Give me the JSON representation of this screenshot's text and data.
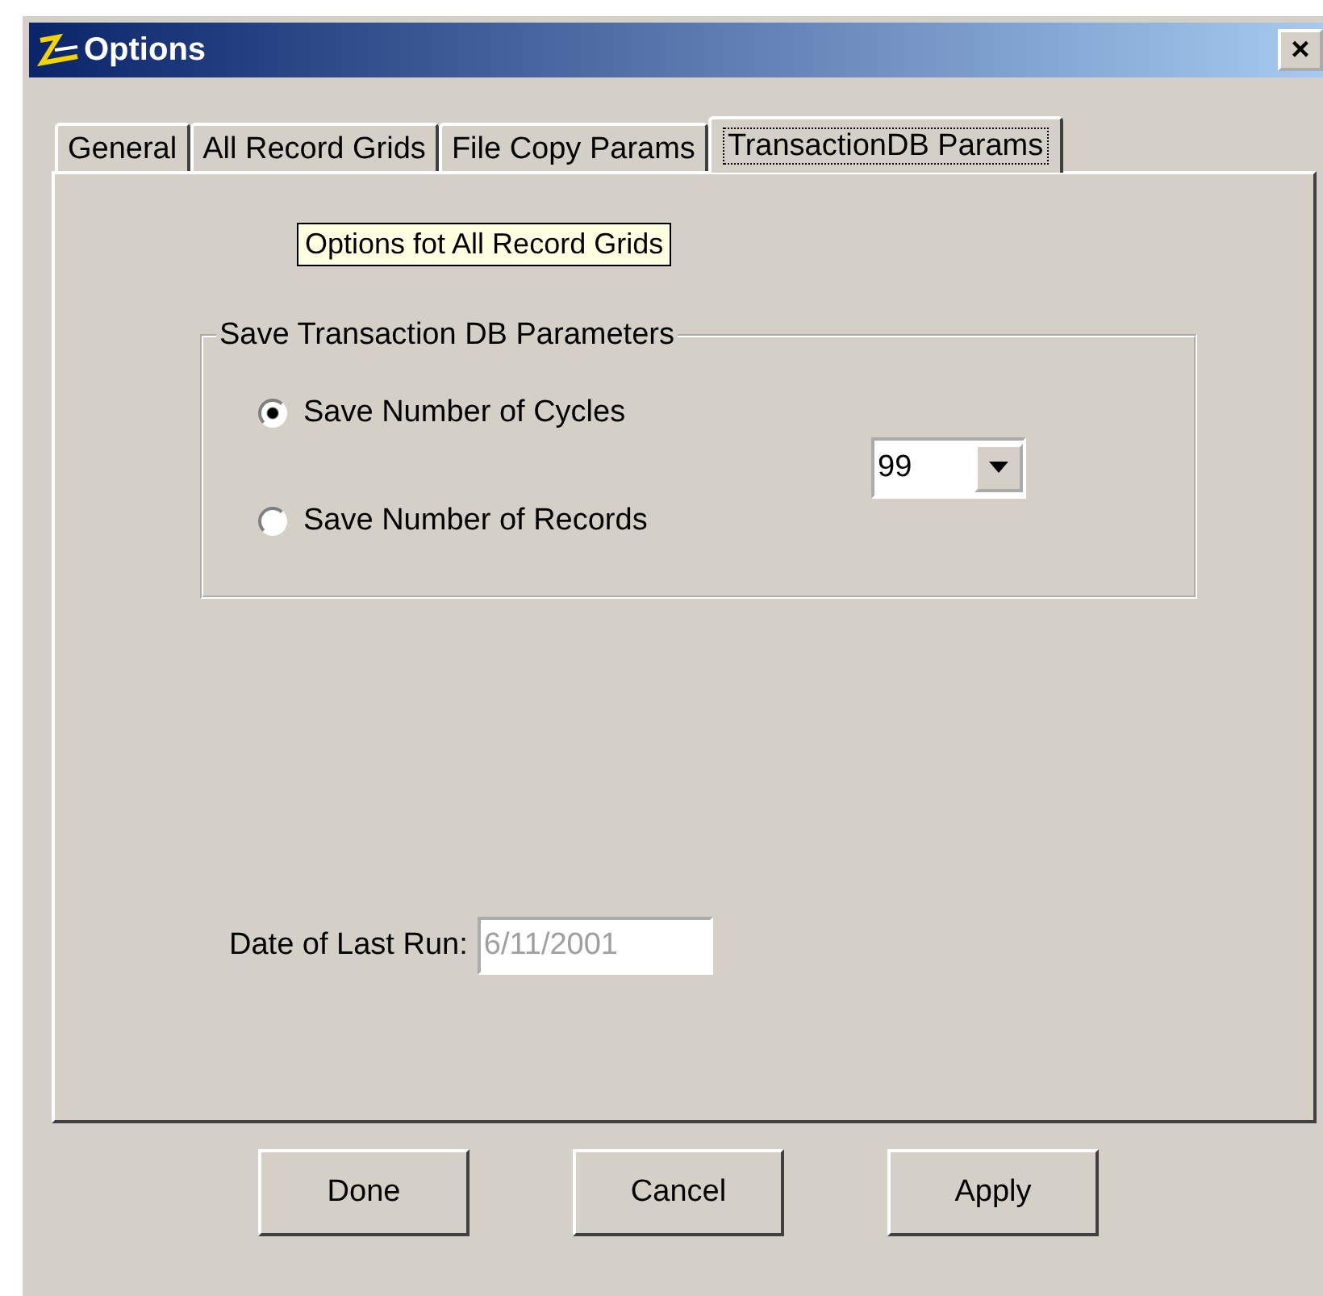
{
  "window": {
    "title": "Options",
    "close": "×"
  },
  "tabs": [
    {
      "label": "General",
      "selected": false
    },
    {
      "label": "All Record Grids",
      "selected": false
    },
    {
      "label": "File Copy Params",
      "selected": false
    },
    {
      "label": "TransactionDB Params",
      "selected": true
    }
  ],
  "tooltip": "Options fot All Record Grids",
  "group": {
    "title": "Save Transaction DB Parameters",
    "radios": [
      {
        "label": "Save Number of Cycles",
        "selected": true
      },
      {
        "label": "Save Number of Records",
        "selected": false
      }
    ],
    "combo": {
      "value": "99"
    }
  },
  "date_field": {
    "label": "Date of Last Run:",
    "value": "6/11/2001",
    "disabled": true
  },
  "buttons": [
    "Done",
    "Cancel",
    "Apply"
  ]
}
